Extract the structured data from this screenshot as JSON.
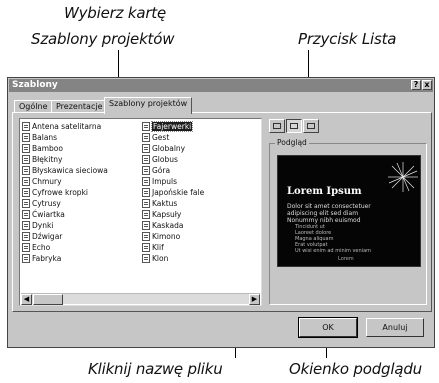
{
  "callouts": {
    "top_line1": "Wybierz kartę",
    "top_line2": "Szablony projektów",
    "list_button": "Przycisk Lista",
    "click_filename": "Kliknij nazwę pliku",
    "preview_window": "Okienko podglądu"
  },
  "dialog": {
    "title": "Szablony",
    "help_button": "?",
    "close_button": "x",
    "tabs": [
      {
        "label": "Ogólne"
      },
      {
        "label": "Prezentacje"
      },
      {
        "label": "Szablony projektów"
      }
    ],
    "active_tab": "Szablony projektów",
    "templates_col1": [
      "Antena satelitarna",
      "Balans",
      "Bamboo",
      "Błękitny",
      "Błyskawica sieciowa",
      "Chmury",
      "Cyfrowe kropki",
      "Cytrusy",
      "Ćwiartka",
      "Dynki",
      "Dźwigar",
      "Echo",
      "Fabryka"
    ],
    "templates_col2": [
      "Fajerwerki",
      "Gest",
      "Globalny",
      "Globus",
      "Góra",
      "Impuls",
      "Japońskie fale",
      "Kaktus",
      "Kapsuły",
      "Kaskada",
      "Kimono",
      "Klif",
      "Klon"
    ],
    "selected_template": "Fajerwerki",
    "preview_label": "Podgląd",
    "preview": {
      "title": "Lorem Ipsum",
      "lines": [
        "Dolor sit amet consectetuer",
        "adipiscing elit sed diam",
        "Nonummy nibh euismod"
      ],
      "sublines": [
        "Tincidunt ut",
        "Laoreet dolore",
        "Magna aliquam",
        "Erat volutpat",
        "Ut wisi enim ad minim veniam"
      ],
      "footer": "Lorem"
    },
    "ok_label": "OK",
    "cancel_label": "Anuluj"
  }
}
